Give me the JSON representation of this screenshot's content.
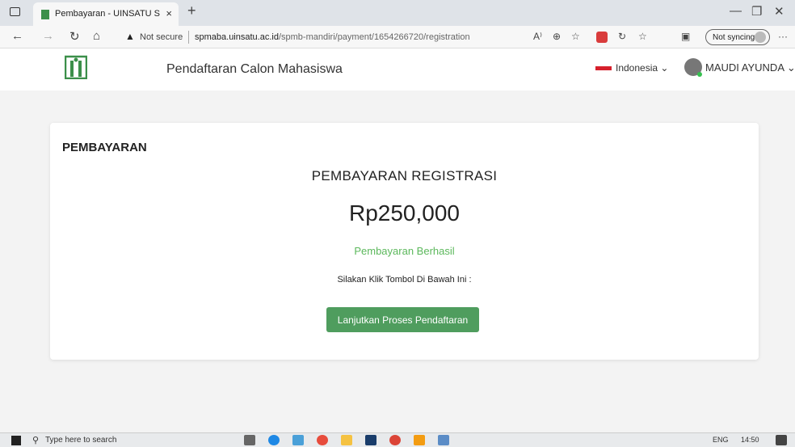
{
  "browser": {
    "tab_title": "Pembayaran - UINSATU SmartC",
    "tab_close": "×",
    "new_tab": "+",
    "not_secure": "Not secure",
    "url_host": "spmaba.uinsatu.ac.id",
    "url_path": "/spmb-mandiri/payment/1654266720/registration",
    "sync_label": "Not syncing",
    "more_menu": "···"
  },
  "header": {
    "site_title": "Pendaftaran Calon Mahasiswa",
    "language": "Indonesia",
    "user_name": "MAUDI AYUNDA"
  },
  "card": {
    "title": "PEMBAYARAN",
    "payment_heading": "PEMBAYARAN REGISTRASI",
    "amount": "Rp250,000",
    "status": "Pembayaran Berhasil",
    "instruction": "Silakan Klik Tombol Di Bawah Ini :",
    "button_label": "Lanjutkan Proses Pendaftaran"
  },
  "taskbar": {
    "search_placeholder": "Type here to search",
    "lang": "ENG",
    "time": "14:50"
  },
  "colors": {
    "accent_green": "#4f9d5e",
    "status_green": "#5cb85c",
    "flag_red": "#d6202c"
  }
}
